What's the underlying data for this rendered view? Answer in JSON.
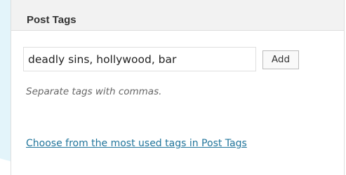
{
  "postbox": {
    "title": "Post Tags",
    "tag_input_value": "deadly sins, hollywood, bar",
    "add_button_label": "Add",
    "hint": "Separate tags with commas.",
    "tagcloud_link": "Choose from the most used tags in Post Tags"
  },
  "colors": {
    "link": "#21759b",
    "background_accent": "#e3f4fa",
    "header_bg": "#e8e8e8"
  }
}
